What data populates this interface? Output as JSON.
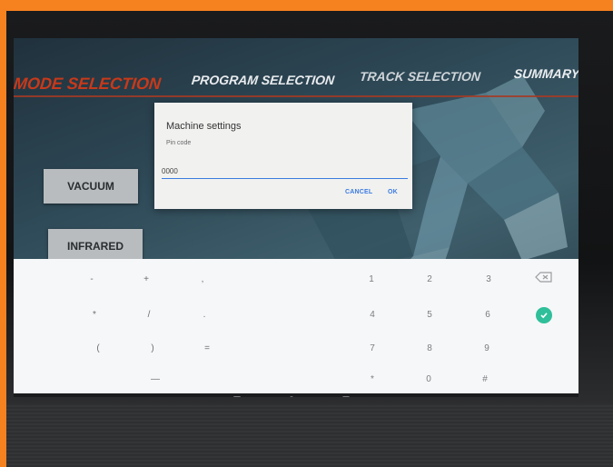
{
  "nav": {
    "mode": "MODE SELECTION",
    "program": "PROGRAM SELECTION",
    "track": "TRACK SELECTION",
    "summary": "SUMMARY"
  },
  "side_buttons": {
    "vacuum": "VACUUM",
    "infrared": "INFRARED"
  },
  "dialog": {
    "title": "Machine settings",
    "subtitle": "Pin code",
    "pin_value": "0000",
    "cancel": "CANCEL",
    "ok": "OK"
  },
  "keyboard": {
    "rows": [
      [
        "-",
        "+",
        ",",
        "1",
        "2",
        "3"
      ],
      [
        "*",
        "/",
        ".",
        "4",
        "5",
        "6"
      ],
      [
        "(",
        ")",
        "=",
        "7",
        "8",
        "9"
      ],
      [
        "",
        "—",
        "",
        "*",
        "0",
        "#"
      ]
    ]
  },
  "colors": {
    "frame": "#f5811f",
    "accent_red": "#c8391a",
    "link_blue": "#3b7be0",
    "check_green": "#2fbf9a"
  }
}
